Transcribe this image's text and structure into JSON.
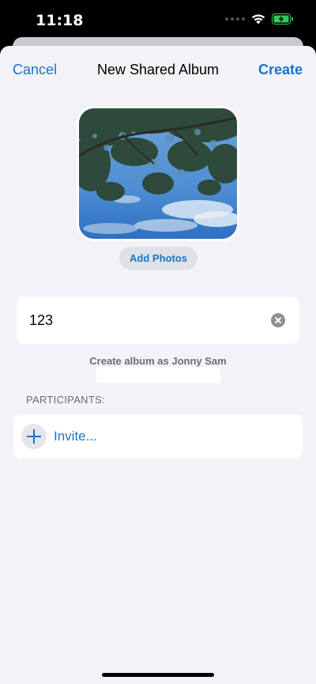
{
  "status_bar": {
    "time": "11:18"
  },
  "nav": {
    "cancel": "Cancel",
    "title": "New Shared Album",
    "create": "Create"
  },
  "photo": {
    "add_label": "Add Photos"
  },
  "album_name": {
    "value": "123"
  },
  "create_as": "Create album as Jonny Sam",
  "participants": {
    "header": "PARTICIPANTS:",
    "invite_label": "Invite..."
  },
  "colors": {
    "accent": "#1a73c8",
    "background": "#f2f2f7",
    "battery": "#34c759"
  },
  "icons": [
    "cellular-icon",
    "wifi-icon",
    "battery-charging-icon",
    "clear-text-icon",
    "add-participant-icon"
  ]
}
